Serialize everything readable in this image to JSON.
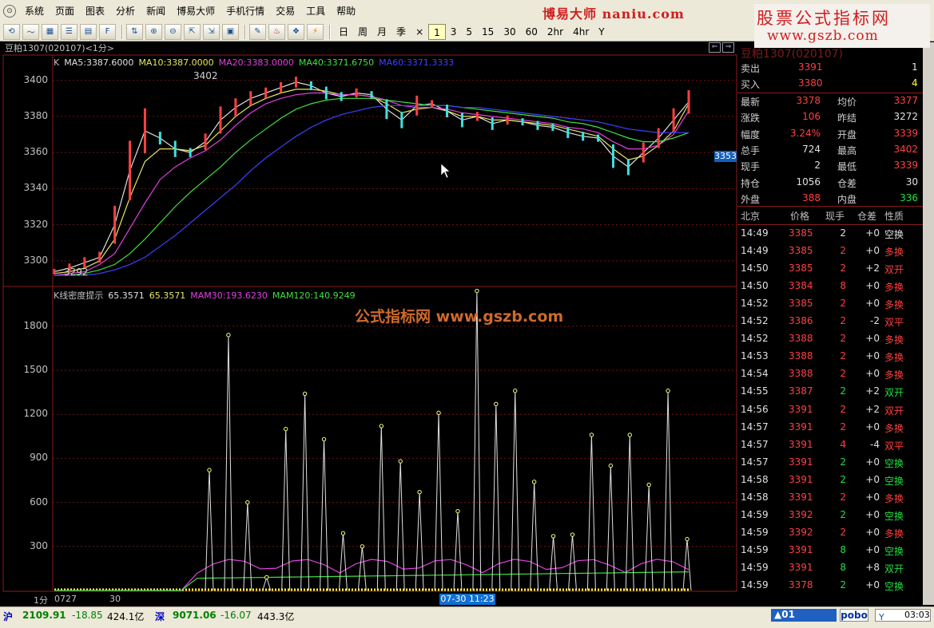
{
  "menu": {
    "items": [
      "系统",
      "页面",
      "图表",
      "分析",
      "新闻",
      "博易大师",
      "手机行情",
      "交易",
      "工具",
      "帮助"
    ],
    "brand_text": "博易大师 naniu.com",
    "promo_line1": "股票公式指标网",
    "promo_line2": "www.gszb.com"
  },
  "toolbar": {
    "periods": [
      "日",
      "周",
      "月",
      "季",
      "×",
      "1",
      "3",
      "5",
      "15",
      "30",
      "60",
      "2hr",
      "4hr",
      "Y"
    ],
    "active_period": "1"
  },
  "chart": {
    "title": "豆粕1307(020107)<1分>",
    "ma_legend": [
      {
        "text": "K",
        "color": "#c0c0c0"
      },
      {
        "text": "MA5:3387.6000",
        "color": "#e0e0e0"
      },
      {
        "text": "MA10:3387.0000",
        "color": "#e8e860"
      },
      {
        "text": "MA20:3383.0000",
        "color": "#e040e0"
      },
      {
        "text": "MA40:3371.6750",
        "color": "#40e040"
      },
      {
        "text": "MA60:3371.3333",
        "color": "#4040ff"
      }
    ],
    "price_ticks": [
      "3400",
      "3380",
      "3360",
      "3340",
      "3320",
      "3300"
    ],
    "high_label": "3402",
    "low_label": "3292",
    "current_price_flag": "3353",
    "indicator_legend": [
      {
        "text": "K线密度提示",
        "color": "#c0c0c0"
      },
      {
        "text": "65.3571",
        "color": "#e0e0e0"
      },
      {
        "text": "65.3571",
        "color": "#e8e860"
      },
      {
        "text": "MAM30:193.6230",
        "color": "#e040e0"
      },
      {
        "text": "MAM120:140.9249",
        "color": "#40e040"
      }
    ],
    "indicator_ticks": [
      "1800",
      "1500",
      "1200",
      "900",
      "600",
      "300"
    ],
    "watermark": "公式指标网  www.gszb.com",
    "xaxis": {
      "period": "1分",
      "start": "0727",
      "mid": "30",
      "cursor": "07-30 11:23"
    }
  },
  "chart_data": {
    "type": "line",
    "title": "豆粕1307(020107)<1分>",
    "price_axis": [
      3292,
      3410
    ],
    "indicator_axis": [
      0,
      2000
    ],
    "series": [
      {
        "name": "MA5",
        "values": [
          3294,
          3296,
          3299,
          3302,
          3320,
          3350,
          3372,
          3368,
          3362,
          3360,
          3366,
          3378,
          3385,
          3390,
          3393,
          3396,
          3399,
          3397,
          3393,
          3391,
          3393,
          3392,
          3384,
          3378,
          3386,
          3387,
          3383,
          3378,
          3380,
          3376,
          3378,
          3377,
          3375,
          3374,
          3371,
          3369,
          3368,
          3358,
          3352,
          3360,
          3368,
          3378,
          3388
        ]
      },
      {
        "name": "MA10",
        "values": [
          3293,
          3294,
          3296,
          3300,
          3312,
          3335,
          3355,
          3362,
          3362,
          3361,
          3364,
          3372,
          3380,
          3386,
          3390,
          3393,
          3395,
          3395,
          3394,
          3392,
          3392,
          3391,
          3387,
          3382,
          3384,
          3385,
          3383,
          3380,
          3380,
          3378,
          3378,
          3377,
          3376,
          3375,
          3373,
          3371,
          3369,
          3362,
          3356,
          3358,
          3364,
          3372,
          3387
        ]
      },
      {
        "name": "MA20",
        "values": [
          3292,
          3293,
          3294,
          3298,
          3304,
          3318,
          3332,
          3345,
          3352,
          3357,
          3361,
          3367,
          3375,
          3382,
          3387,
          3390,
          3392,
          3393,
          3393,
          3392,
          3392,
          3391,
          3389,
          3386,
          3385,
          3385,
          3384,
          3382,
          3381,
          3380,
          3379,
          3378,
          3377,
          3376,
          3374,
          3373,
          3371,
          3366,
          3362,
          3362,
          3364,
          3370,
          3383
        ]
      },
      {
        "name": "MA40",
        "values": [
          3292,
          3292,
          3293,
          3295,
          3298,
          3304,
          3312,
          3321,
          3330,
          3338,
          3345,
          3352,
          3360,
          3367,
          3373,
          3379,
          3384,
          3387,
          3389,
          3390,
          3390,
          3390,
          3389,
          3388,
          3387,
          3386,
          3386,
          3385,
          3384,
          3383,
          3382,
          3381,
          3380,
          3379,
          3377,
          3376,
          3374,
          3371,
          3368,
          3366,
          3366,
          3368,
          3371
        ]
      },
      {
        "name": "MA60",
        "values": [
          3292,
          3292,
          3292,
          3293,
          3295,
          3298,
          3302,
          3308,
          3314,
          3321,
          3328,
          3335,
          3342,
          3350,
          3357,
          3363,
          3369,
          3374,
          3378,
          3381,
          3383,
          3385,
          3386,
          3386,
          3386,
          3386,
          3386,
          3385,
          3385,
          3384,
          3383,
          3382,
          3381,
          3380,
          3379,
          3378,
          3377,
          3375,
          3373,
          3372,
          3371,
          3371,
          3371
        ]
      }
    ],
    "density_peaks": [
      {
        "index": 10,
        "value": 820
      },
      {
        "index": 11,
        "value": 1740
      },
      {
        "index": 12,
        "value": 600
      },
      {
        "index": 13,
        "value": 90
      },
      {
        "index": 14,
        "value": 1100
      },
      {
        "index": 15,
        "value": 1340
      },
      {
        "index": 16,
        "value": 1030
      },
      {
        "index": 17,
        "value": 390
      },
      {
        "index": 18,
        "value": 300
      },
      {
        "index": 19,
        "value": 1120
      },
      {
        "index": 20,
        "value": 880
      },
      {
        "index": 21,
        "value": 670
      },
      {
        "index": 22,
        "value": 1210
      },
      {
        "index": 23,
        "value": 540
      },
      {
        "index": 24,
        "value": 2040
      },
      {
        "index": 25,
        "value": 1270
      },
      {
        "index": 26,
        "value": 1360
      },
      {
        "index": 27,
        "value": 740
      },
      {
        "index": 28,
        "value": 370
      },
      {
        "index": 29,
        "value": 380
      },
      {
        "index": 30,
        "value": 1060
      },
      {
        "index": 31,
        "value": 850
      },
      {
        "index": 32,
        "value": 1060
      },
      {
        "index": 33,
        "value": 720
      },
      {
        "index": 34,
        "value": 1360
      },
      {
        "index": 35,
        "value": 350
      }
    ],
    "mam30_level": 193.623,
    "mam120_level": 140.9249
  },
  "quote": {
    "title": "豆粕1307(020107)",
    "rows": [
      {
        "l1": "卖出",
        "v1": "3391",
        "c1": "red",
        "v2": "1",
        "c2": "white"
      },
      {
        "l1": "买入",
        "v1": "3380",
        "c1": "red",
        "v2": "4",
        "c2": "yellow"
      }
    ],
    "stats": [
      {
        "l1": "最新",
        "v1": "3378",
        "c1": "red",
        "l2": "均价",
        "v2": "3377",
        "c2": "red"
      },
      {
        "l1": "涨跌",
        "v1": "106",
        "c1": "red",
        "l2": "昨结",
        "v2": "3272",
        "c2": "white"
      },
      {
        "l1": "幅度",
        "v1": "3.24%",
        "c1": "red",
        "l2": "开盘",
        "v2": "3339",
        "c2": "red"
      },
      {
        "l1": "总手",
        "v1": "724",
        "c1": "white",
        "l2": "最高",
        "v2": "3402",
        "c2": "red"
      },
      {
        "l1": "现手",
        "v1": "2",
        "c1": "white",
        "l2": "最低",
        "v2": "3339",
        "c2": "red"
      },
      {
        "l1": "持仓",
        "v1": "1056",
        "c1": "white",
        "l2": "仓差",
        "v2": "30",
        "c2": "white"
      },
      {
        "l1": "外盘",
        "v1": "388",
        "c1": "red",
        "l2": "内盘",
        "v2": "336",
        "c2": "green"
      }
    ],
    "tick_header": [
      "北京",
      "价格",
      "现手",
      "仓差",
      "性质"
    ],
    "ticks": [
      {
        "time": "14:49",
        "price": "3385",
        "vol": "2",
        "vc": "white",
        "oi": "+0",
        "nature": "空换",
        "nc": "white"
      },
      {
        "time": "14:49",
        "price": "3385",
        "vol": "2",
        "vc": "red",
        "oi": "+0",
        "nature": "多换",
        "nc": "red"
      },
      {
        "time": "14:50",
        "price": "3385",
        "vol": "2",
        "vc": "red",
        "oi": "+2",
        "nature": "双开",
        "nc": "red"
      },
      {
        "time": "14:50",
        "price": "3384",
        "vol": "8",
        "vc": "red",
        "oi": "+0",
        "nature": "多换",
        "nc": "red"
      },
      {
        "time": "14:52",
        "price": "3385",
        "vol": "2",
        "vc": "red",
        "oi": "+0",
        "nature": "多换",
        "nc": "red"
      },
      {
        "time": "14:52",
        "price": "3386",
        "vol": "2",
        "vc": "red",
        "oi": "-2",
        "nature": "双平",
        "nc": "red"
      },
      {
        "time": "14:52",
        "price": "3388",
        "vol": "2",
        "vc": "red",
        "oi": "+0",
        "nature": "多换",
        "nc": "red"
      },
      {
        "time": "14:53",
        "price": "3388",
        "vol": "2",
        "vc": "red",
        "oi": "+0",
        "nature": "多换",
        "nc": "red"
      },
      {
        "time": "14:54",
        "price": "3388",
        "vol": "2",
        "vc": "red",
        "oi": "+0",
        "nature": "多换",
        "nc": "red"
      },
      {
        "time": "14:55",
        "price": "3387",
        "vol": "2",
        "vc": "green",
        "oi": "+2",
        "nature": "双开",
        "nc": "green"
      },
      {
        "time": "14:56",
        "price": "3391",
        "vol": "2",
        "vc": "red",
        "oi": "+2",
        "nature": "双开",
        "nc": "red"
      },
      {
        "time": "14:57",
        "price": "3391",
        "vol": "2",
        "vc": "red",
        "oi": "+0",
        "nature": "多换",
        "nc": "red"
      },
      {
        "time": "14:57",
        "price": "3391",
        "vol": "4",
        "vc": "red",
        "oi": "-4",
        "nature": "双平",
        "nc": "red"
      },
      {
        "time": "14:57",
        "price": "3391",
        "vol": "2",
        "vc": "green",
        "oi": "+0",
        "nature": "空换",
        "nc": "green"
      },
      {
        "time": "14:58",
        "price": "3391",
        "vol": "2",
        "vc": "green",
        "oi": "+0",
        "nature": "空换",
        "nc": "green"
      },
      {
        "time": "14:58",
        "price": "3391",
        "vol": "2",
        "vc": "red",
        "oi": "+0",
        "nature": "多换",
        "nc": "red"
      },
      {
        "time": "14:59",
        "price": "3392",
        "vol": "2",
        "vc": "green",
        "oi": "+0",
        "nature": "空换",
        "nc": "green"
      },
      {
        "time": "14:59",
        "price": "3392",
        "vol": "2",
        "vc": "red",
        "oi": "+0",
        "nature": "多换",
        "nc": "red"
      },
      {
        "time": "14:59",
        "price": "3391",
        "vol": "8",
        "vc": "green",
        "oi": "+0",
        "nature": "空换",
        "nc": "green"
      },
      {
        "time": "14:59",
        "price": "3391",
        "vol": "8",
        "vc": "green",
        "oi": "+8",
        "nature": "双开",
        "nc": "green"
      },
      {
        "time": "14:59",
        "price": "3378",
        "vol": "2",
        "vc": "green",
        "oi": "+0",
        "nature": "空换",
        "nc": "green"
      }
    ]
  },
  "statusbar": {
    "sh_label": "沪",
    "sh_value": "2109.91",
    "sh_change": "-18.85",
    "sh_amount": "424.1亿",
    "sz_label": "深",
    "sz_value": "9071.06",
    "sz_change": "-16.07",
    "sz_amount": "443.3亿",
    "alert": "▲01",
    "pobo": "pobo",
    "clock": "03:03"
  }
}
